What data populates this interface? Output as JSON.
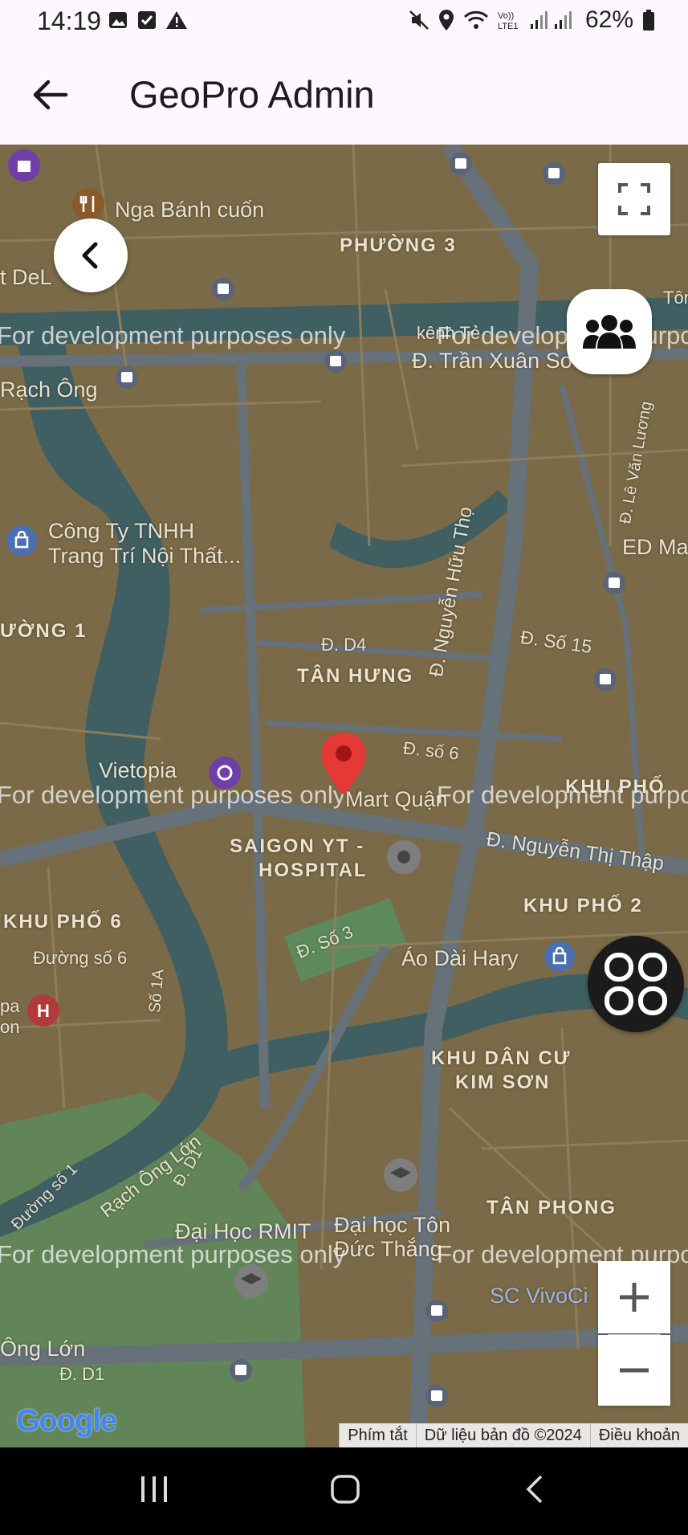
{
  "status": {
    "time": "14:19",
    "battery": "62%",
    "icons": [
      "image-icon",
      "check-icon",
      "alert-icon",
      "mute-icon",
      "location-icon",
      "wifi-icon",
      "lte-icon",
      "signal-icon",
      "battery-icon"
    ]
  },
  "app_bar": {
    "title": "GeoPro Admin"
  },
  "map": {
    "watermark": "For development purposes only",
    "labels": [
      "Nga Bánh cuốn",
      "PHƯỜNG 3",
      "t DeL",
      "Rạch Ông",
      "Đ. Trần Xuân So",
      "kênh Tẻ",
      "Công Ty TNHH",
      "Trang Trí Nội Thất...",
      "ƯỜNG 1",
      "Đ. D4",
      "TÂN HƯNG",
      "Đ. Nguyễn Hữu Thọ",
      "Đ. Số 15",
      "ED Ma",
      "Đ. Lê Văn Lương",
      "Vietopia",
      "Đ. số 6",
      "Mart Quận",
      "KHU PHỐ",
      "SAIGON YT -",
      "HOSPITAL",
      "Đ. Nguyễn Thị Thập",
      "KHU PHỐ 2",
      "KHU PHỐ 6",
      "Đường số 6",
      "Số 1A",
      "Đ. Số 3",
      "Áo Dài Hary",
      "KHU DÂN CƯ",
      "KIM SƠN",
      "Rạch Ông Lớn",
      "Đ. D1",
      "Đường số 1",
      "TÂN PHONG",
      "Đại Học RMIT",
      "Đại học Tôn",
      "Đức Thắng",
      "SC VivoCi",
      "Ông Lớn",
      "Đ. D1",
      "pa",
      "on",
      "Tôn"
    ],
    "google_logo": "Google",
    "attribution": [
      "Phím tắt",
      "Dữ liệu bản đồ ©2024",
      "Điều khoản"
    ]
  },
  "colors": {
    "marker": "#e53935",
    "map_bg": "#7a6a47",
    "water": "#3f5f63",
    "park": "#5d8a5c"
  }
}
